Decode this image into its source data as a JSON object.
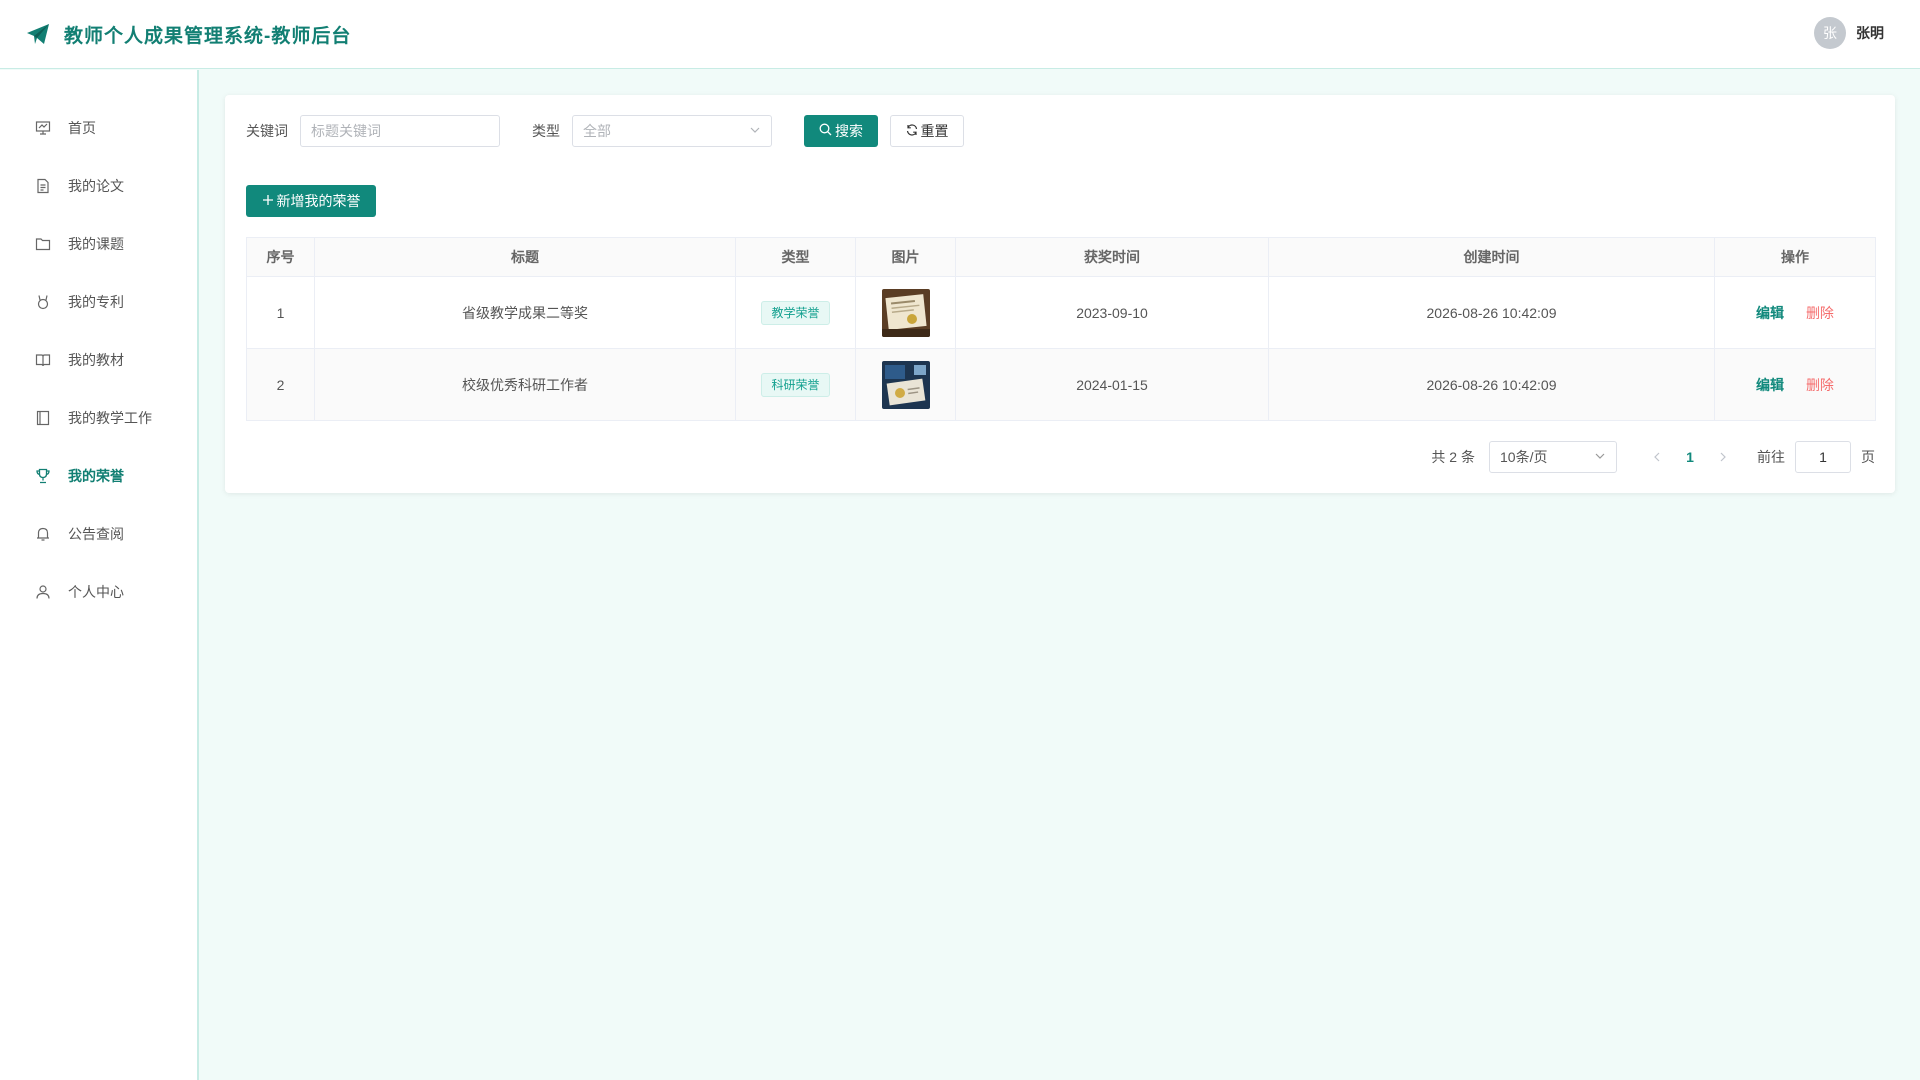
{
  "header": {
    "title": "教师个人成果管理系统-教师后台",
    "avatar_text": "张",
    "user_name": "张明"
  },
  "sidebar": {
    "items": [
      {
        "label": "首页",
        "icon": "presentation-icon",
        "active": false
      },
      {
        "label": "我的论文",
        "icon": "document-icon",
        "active": false
      },
      {
        "label": "我的课题",
        "icon": "folder-icon",
        "active": false
      },
      {
        "label": "我的专利",
        "icon": "medal-icon",
        "active": false
      },
      {
        "label": "我的教材",
        "icon": "book-icon",
        "active": false
      },
      {
        "label": "我的教学工作",
        "icon": "notebook-icon",
        "active": false
      },
      {
        "label": "我的荣誉",
        "icon": "trophy-icon",
        "active": true
      },
      {
        "label": "公告查阅",
        "icon": "bell-icon",
        "active": false
      },
      {
        "label": "个人中心",
        "icon": "user-icon",
        "active": false
      }
    ]
  },
  "search": {
    "keyword_label": "关键词",
    "keyword_placeholder": "标题关键词",
    "type_label": "类型",
    "type_value": "全部",
    "search_button": "搜索",
    "reset_button": "重置"
  },
  "add_button": "新增我的荣誉",
  "table": {
    "headers": [
      "序号",
      "标题",
      "类型",
      "图片",
      "获奖时间",
      "创建时间",
      "操作"
    ],
    "rows": [
      {
        "index": "1",
        "title": "省级教学成果二等奖",
        "type": "教学荣誉",
        "award_time": "2023-09-10",
        "created_at": "2026-08-26 10:42:09",
        "edit": "编辑",
        "delete": "删除"
      },
      {
        "index": "2",
        "title": "校级优秀科研工作者",
        "type": "科研荣誉",
        "award_time": "2024-01-15",
        "created_at": "2026-08-26 10:42:09",
        "edit": "编辑",
        "delete": "删除"
      }
    ]
  },
  "pagination": {
    "total_text": "共 2 条",
    "page_size": "10条/页",
    "current_page": "1",
    "goto_label": "前往",
    "goto_value": "1",
    "page_suffix": "页"
  },
  "colors": {
    "primary": "#11897c",
    "danger": "#f56c6c",
    "background": "#f1fbf9"
  }
}
